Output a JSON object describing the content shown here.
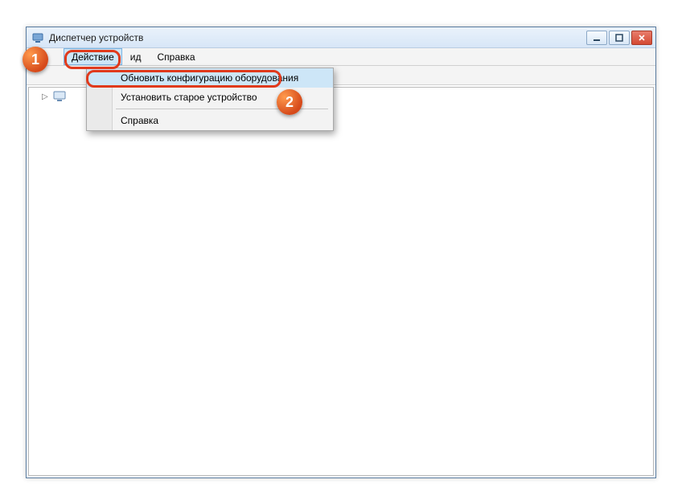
{
  "window": {
    "title": "Диспетчер устройств"
  },
  "menubar": {
    "action": "Действие",
    "view_suffix": "ид",
    "help": "Справка"
  },
  "dropdown": {
    "update_hw": "Обновить конфигурацию оборудования",
    "install_legacy": "Установить старое устройство",
    "help": "Справка"
  },
  "tree": {
    "root_label": ""
  },
  "callouts": {
    "one": "1",
    "two": "2"
  }
}
